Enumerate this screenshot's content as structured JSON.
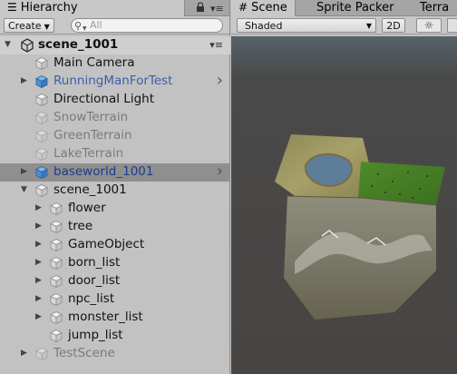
{
  "hierarchy": {
    "tab_label": "Hierarchy",
    "create_label": "Create",
    "search_placeholder": "All"
  },
  "scene_root": {
    "label": "scene_1001"
  },
  "tree": [
    {
      "label": "Main Camera",
      "color": "#111111",
      "selected": false,
      "expandable": false,
      "prefab": false
    },
    {
      "label": "RunningManForTest",
      "color": "#3a5fa8",
      "selected": false,
      "expandable": true,
      "prefab": true
    },
    {
      "label": "Directional Light",
      "color": "#111111",
      "selected": false,
      "expandable": false,
      "prefab": false
    },
    {
      "label": "SnowTerrain",
      "color": "#7a7a7a",
      "selected": false,
      "expandable": false,
      "prefab": false
    },
    {
      "label": "GreenTerrain",
      "color": "#7a7a7a",
      "selected": false,
      "expandable": false,
      "prefab": false
    },
    {
      "label": "LakeTerrain",
      "color": "#7a7a7a",
      "selected": false,
      "expandable": false,
      "prefab": false
    },
    {
      "label": "baseworld_1001",
      "color": "#1a3d8f",
      "selected": true,
      "expandable": true,
      "prefab": true
    },
    {
      "label": "scene_1001",
      "color": "#111111",
      "selected": false,
      "expandable": true,
      "expanded": true,
      "prefab": false
    },
    {
      "label": "flower",
      "color": "#111111",
      "selected": false,
      "expandable": true,
      "prefab": false,
      "child": true
    },
    {
      "label": "tree",
      "color": "#111111",
      "selected": false,
      "expandable": true,
      "prefab": false,
      "child": true
    },
    {
      "label": "GameObject",
      "color": "#111111",
      "selected": false,
      "expandable": true,
      "prefab": false,
      "child": true
    },
    {
      "label": "born_list",
      "color": "#111111",
      "selected": false,
      "expandable": true,
      "prefab": false,
      "child": true
    },
    {
      "label": "door_list",
      "color": "#111111",
      "selected": false,
      "expandable": true,
      "prefab": false,
      "child": true
    },
    {
      "label": "npc_list",
      "color": "#111111",
      "selected": false,
      "expandable": true,
      "prefab": false,
      "child": true
    },
    {
      "label": "monster_list",
      "color": "#111111",
      "selected": false,
      "expandable": true,
      "prefab": false,
      "child": true
    },
    {
      "label": "jump_list",
      "color": "#111111",
      "selected": false,
      "expandable": false,
      "prefab": false,
      "child": true
    },
    {
      "label": "TestScene",
      "color": "#7a7a7a",
      "selected": false,
      "expandable": true,
      "prefab": false
    }
  ],
  "scene_view": {
    "tabs": [
      "Scene",
      "Sprite Packer",
      "Terra"
    ],
    "shading_mode": "Shaded",
    "mode_2d": "2D"
  },
  "colors": {
    "panel_bg": "#c2c2c2",
    "selection": "#8f8f8f",
    "prefab_blue": "#3a5fa8",
    "viewport_bg": "#4a4746"
  }
}
